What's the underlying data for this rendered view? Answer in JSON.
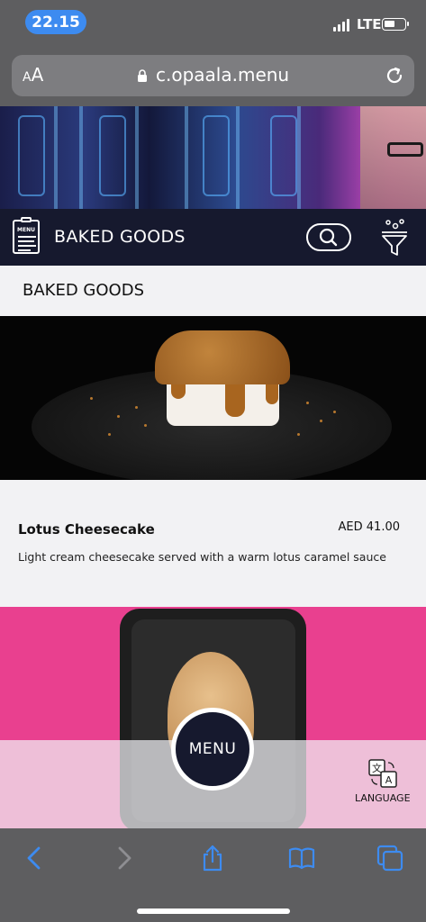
{
  "status_bar": {
    "time": "22.15",
    "network": "LTE"
  },
  "browser": {
    "text_size_label": "AA",
    "url": "c.opaala.menu"
  },
  "header": {
    "title": "BAKED GOODS",
    "menu_icon_label": "MENU"
  },
  "section": {
    "title": "BAKED GOODS"
  },
  "products": [
    {
      "name": "Lotus Cheesecake",
      "price": "AED 41.00",
      "description": "Light cream cheesecake served with a warm lotus caramel sauce"
    }
  ],
  "floating": {
    "menu_button": "MENU",
    "language_label": "LANGUAGE"
  },
  "icons": {
    "status": [
      "signal-icon",
      "battery-icon"
    ],
    "browser": [
      "lock-icon",
      "reload-icon"
    ],
    "header": [
      "menu-card-icon",
      "search-icon",
      "filter-icon"
    ],
    "toolbar": [
      "back-icon",
      "forward-icon",
      "share-icon",
      "bookmarks-icon",
      "tabs-icon"
    ],
    "floating": [
      "translate-icon"
    ]
  },
  "colors": {
    "header_bg": "#16192e",
    "safari_chrome": "#5e5e60",
    "time_pill": "#3d8bf0",
    "toolbar_icon": "#3d8bf0",
    "page_bg": "#f2f2f4",
    "product2_bg": "#e9408f"
  }
}
